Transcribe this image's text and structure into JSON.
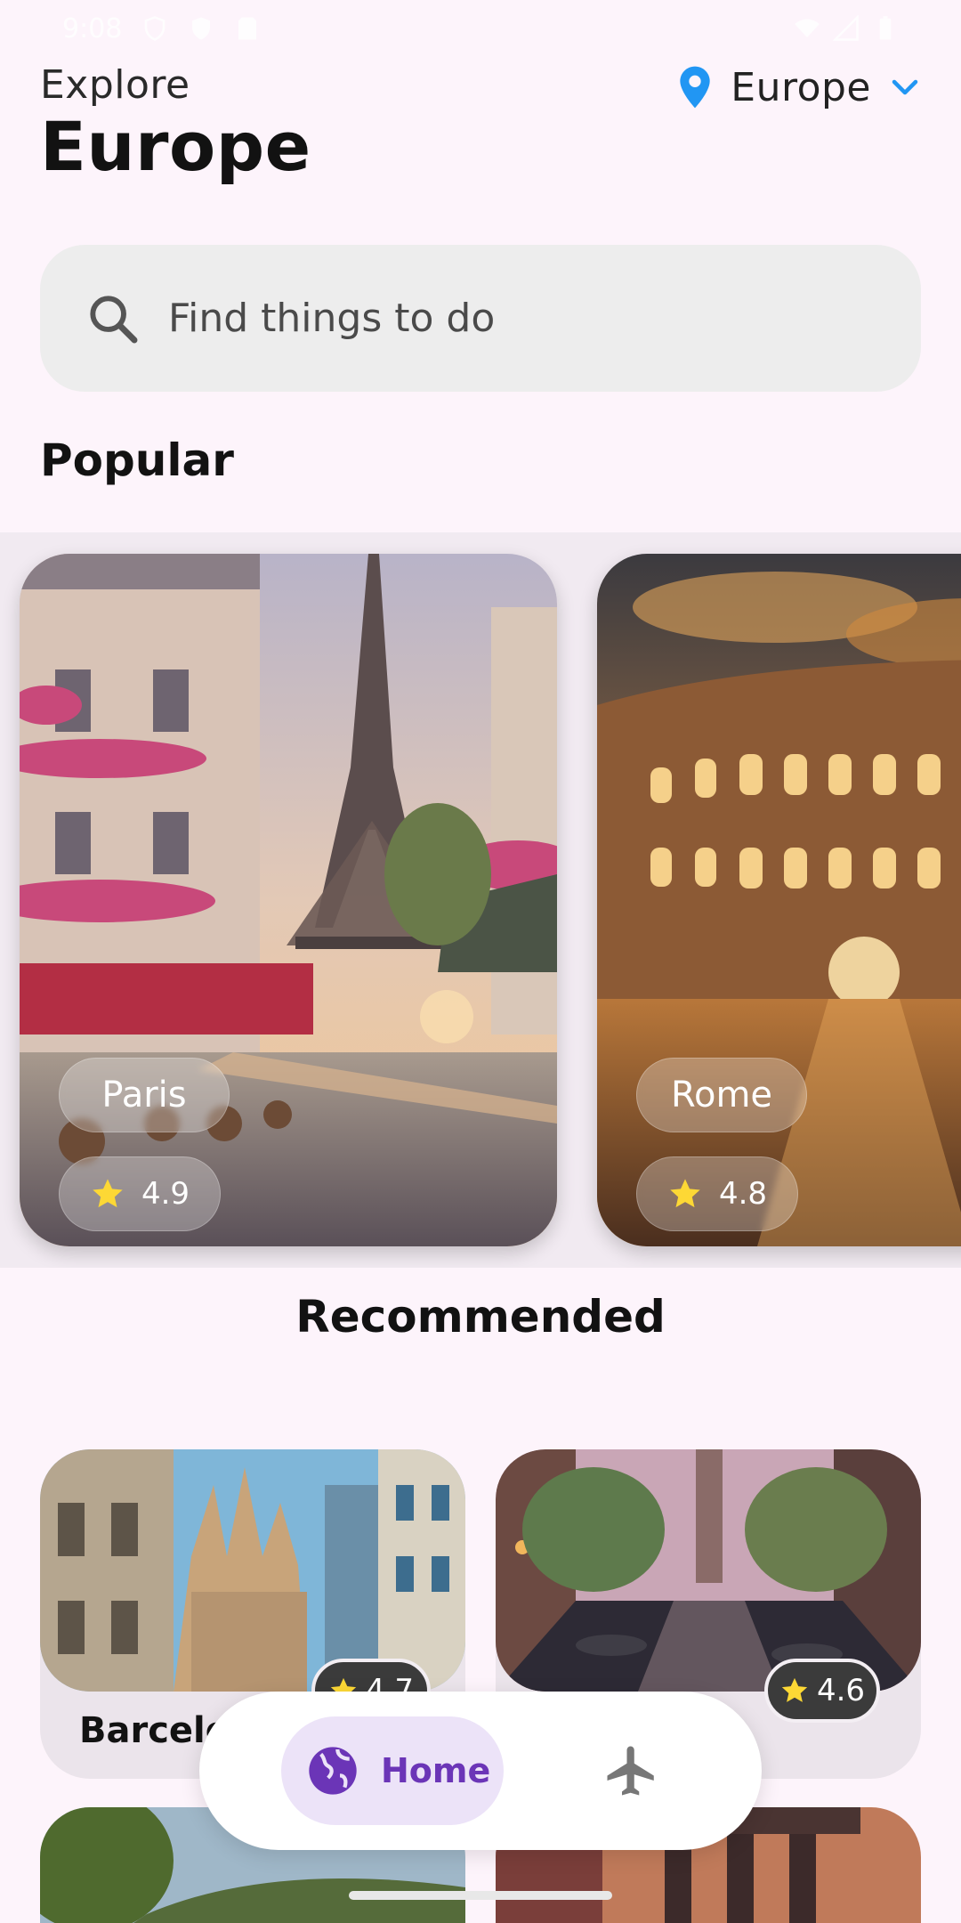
{
  "status_bar": {
    "time": "9:08"
  },
  "header": {
    "explore_label": "Explore",
    "title": "Europe",
    "region": {
      "label": "Europe",
      "icon": "location-pin-icon"
    }
  },
  "search": {
    "placeholder": "Find things to do",
    "value": ""
  },
  "popular": {
    "title": "Popular",
    "items": [
      {
        "name": "Paris",
        "rating": "4.9"
      },
      {
        "name": "Rome",
        "rating": "4.8"
      }
    ]
  },
  "recommended": {
    "title": "Recommended",
    "items": [
      {
        "name": "Barcelo",
        "rating": "4.7"
      },
      {
        "name": "",
        "rating": "4.6"
      }
    ]
  },
  "nav": {
    "home_label": "Home",
    "flights_icon": "airplane-icon"
  },
  "colors": {
    "background": "#fdf4fb",
    "accent": "#6b35b7",
    "nav_active": "#ece3f8",
    "pin": "#2196f3",
    "star": "#fdd835"
  }
}
